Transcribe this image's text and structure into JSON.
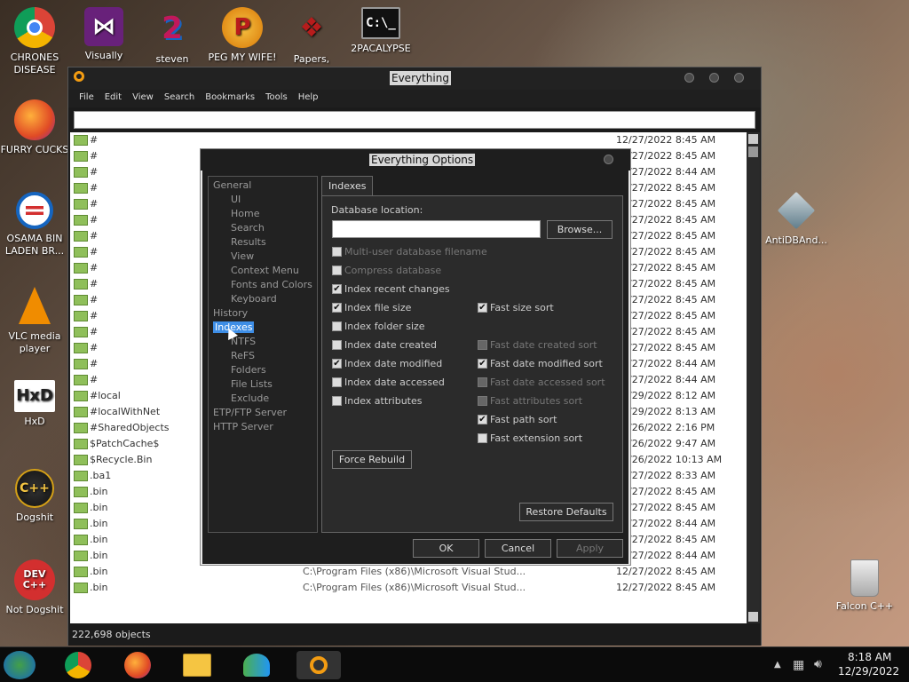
{
  "desktop": {
    "icons": [
      {
        "label": "CHRONES DISEASE"
      },
      {
        "label": "FURRY CUCKS"
      },
      {
        "label": "OSAMA BIN LADEN BR..."
      },
      {
        "label": "VLC media player"
      },
      {
        "label": "HxD"
      },
      {
        "label": "Dogshit"
      },
      {
        "label": "Not Dogshit"
      },
      {
        "label": "Visually"
      },
      {
        "label": "steven"
      },
      {
        "label": "PEG MY WIFE!"
      },
      {
        "label": "Papers,"
      },
      {
        "label": "2PACALYPSE"
      },
      {
        "label": "AntiDBAnd..."
      },
      {
        "label": "Falcon C++"
      }
    ]
  },
  "app": {
    "title": "Everything",
    "menu": [
      "File",
      "Edit",
      "View",
      "Search",
      "Bookmarks",
      "Tools",
      "Help"
    ],
    "rows": [
      {
        "name": "#",
        "path": "",
        "date": "12/27/2022 8:45 AM"
      },
      {
        "name": "#",
        "path": "",
        "date": "12/27/2022 8:45 AM"
      },
      {
        "name": "#",
        "path": "",
        "date": "12/27/2022 8:44 AM"
      },
      {
        "name": "#",
        "path": "",
        "date": "12/27/2022 8:45 AM"
      },
      {
        "name": "#",
        "path": "",
        "date": "12/27/2022 8:45 AM"
      },
      {
        "name": "#",
        "path": "",
        "date": "12/27/2022 8:45 AM"
      },
      {
        "name": "#",
        "path": "",
        "date": "12/27/2022 8:45 AM"
      },
      {
        "name": "#",
        "path": "",
        "date": "12/27/2022 8:45 AM"
      },
      {
        "name": "#",
        "path": "",
        "date": "12/27/2022 8:45 AM"
      },
      {
        "name": "#",
        "path": "",
        "date": "12/27/2022 8:45 AM"
      },
      {
        "name": "#",
        "path": "",
        "date": "12/27/2022 8:45 AM"
      },
      {
        "name": "#",
        "path": "",
        "date": "12/27/2022 8:45 AM"
      },
      {
        "name": "#",
        "path": "",
        "date": "12/27/2022 8:45 AM"
      },
      {
        "name": "#",
        "path": "",
        "date": "12/27/2022 8:45 AM"
      },
      {
        "name": "#",
        "path": "",
        "date": "12/27/2022 8:44 AM"
      },
      {
        "name": "#",
        "path": "",
        "date": "12/27/2022 8:44 AM"
      },
      {
        "name": "#local",
        "path": "",
        "date": "12/29/2022 8:12 AM"
      },
      {
        "name": "#localWithNet",
        "path": "",
        "date": "12/29/2022 8:13 AM"
      },
      {
        "name": "#SharedObjects",
        "path": "",
        "date": "12/26/2022 2:16 PM"
      },
      {
        "name": "$PatchCache$",
        "path": "",
        "date": "12/26/2022 9:47 AM"
      },
      {
        "name": "$Recycle.Bin",
        "path": "",
        "date": "12/26/2022 10:13 AM"
      },
      {
        "name": ".ba1",
        "path": "",
        "date": "12/27/2022 8:33 AM"
      },
      {
        "name": ".bin",
        "path": "",
        "date": "12/27/2022 8:45 AM"
      },
      {
        "name": ".bin",
        "path": "",
        "date": "12/27/2022 8:45 AM"
      },
      {
        "name": ".bin",
        "path": "",
        "date": "12/27/2022 8:44 AM"
      },
      {
        "name": ".bin",
        "path": "",
        "date": "12/27/2022 8:45 AM"
      },
      {
        "name": ".bin",
        "path": "C:\\Program Files (x86)\\Microsoft Visual Stud...",
        "date": "12/27/2022 8:44 AM"
      },
      {
        "name": ".bin",
        "path": "C:\\Program Files (x86)\\Microsoft Visual Stud...",
        "date": "12/27/2022 8:45 AM"
      },
      {
        "name": ".bin",
        "path": "C:\\Program Files (x86)\\Microsoft Visual Stud...",
        "date": "12/27/2022 8:45 AM"
      }
    ],
    "status": "222,698 objects"
  },
  "dialog": {
    "title": "Everything Options",
    "tree": {
      "general": "General",
      "ui": "UI",
      "home": "Home",
      "search": "Search",
      "results": "Results",
      "view": "View",
      "context_menu": "Context Menu",
      "fonts_colors": "Fonts and Colors",
      "keyboard": "Keyboard",
      "history": "History",
      "indexes": "Indexes",
      "ntfs": "NTFS",
      "refs": "ReFS",
      "folders": "Folders",
      "file_lists": "File Lists",
      "exclude": "Exclude",
      "etp": "ETP/FTP Server",
      "http": "HTTP Server"
    },
    "tab": "Indexes",
    "db_location_label": "Database location:",
    "db_location_value": "",
    "browse": "Browse...",
    "options": {
      "multi_user": {
        "label": "Multi-user database filename",
        "checked": false
      },
      "compress": {
        "label": "Compress database",
        "checked": false
      },
      "recent": {
        "label": "Index recent changes",
        "checked": true
      },
      "file_size": {
        "label": "Index file size",
        "checked": true
      },
      "folder_size": {
        "label": "Index folder size",
        "checked": false
      },
      "date_created": {
        "label": "Index date created",
        "checked": false
      },
      "date_modified": {
        "label": "Index date modified",
        "checked": true
      },
      "date_accessed": {
        "label": "Index date accessed",
        "checked": false
      },
      "attributes": {
        "label": "Index attributes",
        "checked": false
      },
      "fast_size": {
        "label": "Fast size sort",
        "checked": true
      },
      "fast_created": {
        "label": "Fast date created sort",
        "checked": false
      },
      "fast_modified": {
        "label": "Fast date modified sort",
        "checked": true
      },
      "fast_accessed": {
        "label": "Fast date accessed sort",
        "checked": false
      },
      "fast_attributes": {
        "label": "Fast attributes sort",
        "checked": false
      },
      "fast_path": {
        "label": "Fast path sort",
        "checked": true
      },
      "fast_ext": {
        "label": "Fast extension sort",
        "checked": false
      }
    },
    "force_rebuild": "Force Rebuild",
    "restore_defaults": "Restore Defaults",
    "ok": "OK",
    "cancel": "Cancel",
    "apply": "Apply"
  },
  "taskbar": {
    "time": "8:18 AM",
    "date": "12/29/2022"
  },
  "colors": {
    "selection": "#3e8ee6",
    "folder": "#8fbf5a"
  }
}
